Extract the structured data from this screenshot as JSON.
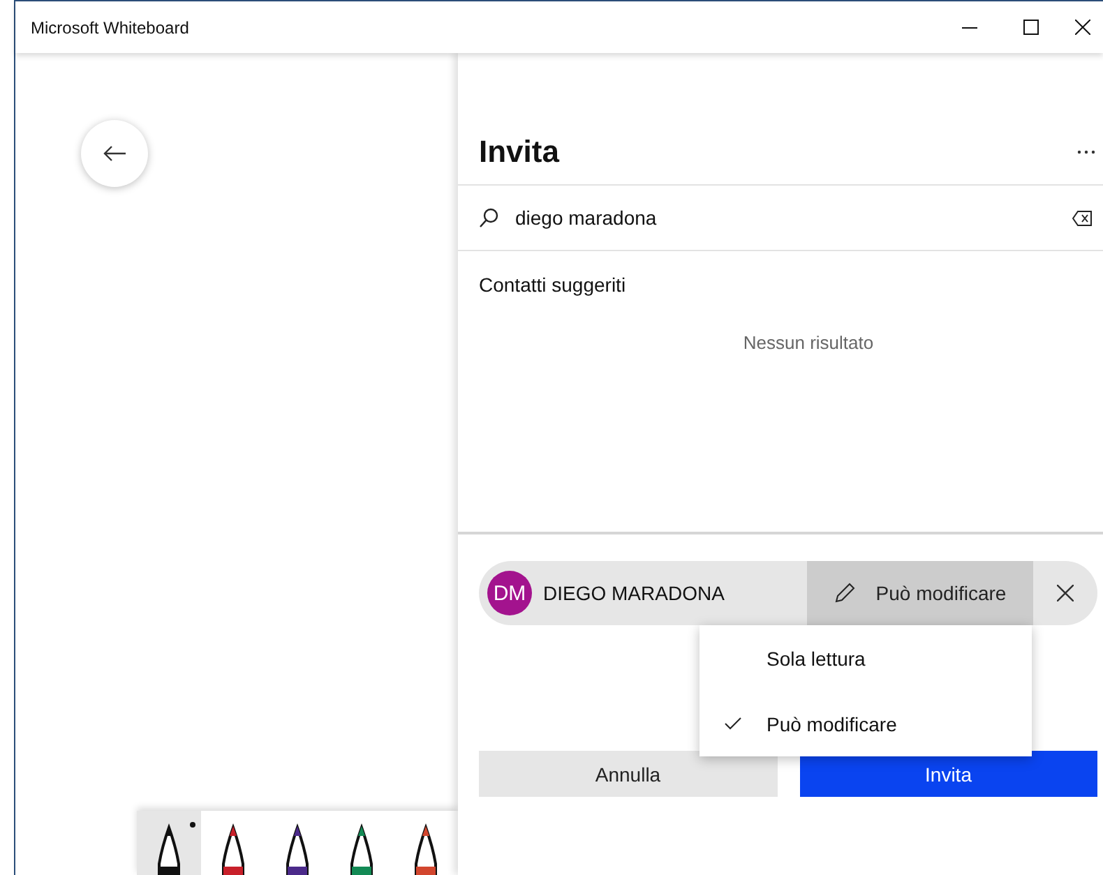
{
  "window": {
    "title": "Microsoft Whiteboard"
  },
  "canvas": {
    "pens": [
      {
        "color": "#111111",
        "selected": true
      },
      {
        "color": "#c8202a",
        "selected": false
      },
      {
        "color": "#4b2a8a",
        "selected": false
      },
      {
        "color": "#138a55",
        "selected": false
      },
      {
        "color": "#d2462e",
        "selected": false
      }
    ]
  },
  "invite_panel": {
    "title": "Invita",
    "search": {
      "value": "diego maradona"
    },
    "section_title": "Contatti suggeriti",
    "empty_message": "Nessun risultato",
    "invitee": {
      "initials": "DM",
      "name": "DIEGO MARADONA",
      "permission": "Può modificare"
    },
    "permission_menu": [
      {
        "label": "Sola lettura",
        "checked": false
      },
      {
        "label": "Può modificare",
        "checked": true
      }
    ],
    "buttons": [
      {
        "label": "Annulla",
        "kind": "secondary"
      },
      {
        "label": "Invita",
        "kind": "primary"
      }
    ]
  }
}
